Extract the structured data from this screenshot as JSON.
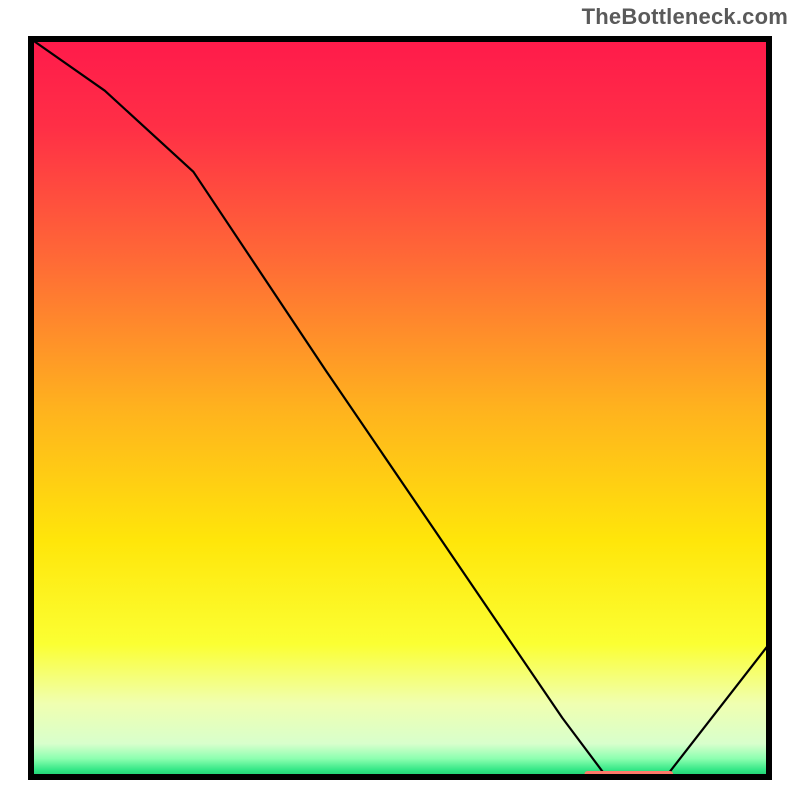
{
  "watermark": "TheBottleneck.com",
  "chart_data": {
    "type": "line",
    "title": "",
    "xlabel": "",
    "ylabel": "",
    "xlim": [
      0,
      100
    ],
    "ylim": [
      0,
      100
    ],
    "grid": false,
    "legend": false,
    "x": [
      0,
      10,
      22,
      40,
      55,
      72,
      78,
      86,
      100
    ],
    "values": [
      100,
      93,
      82,
      55,
      33,
      8,
      0,
      0,
      18
    ],
    "gradient_stops": [
      {
        "offset": 0.0,
        "color": "#ff1a4b"
      },
      {
        "offset": 0.12,
        "color": "#ff2f46"
      },
      {
        "offset": 0.3,
        "color": "#ff6a36"
      },
      {
        "offset": 0.5,
        "color": "#ffb21e"
      },
      {
        "offset": 0.68,
        "color": "#ffe60a"
      },
      {
        "offset": 0.82,
        "color": "#fbff33"
      },
      {
        "offset": 0.9,
        "color": "#f0ffb0"
      },
      {
        "offset": 0.955,
        "color": "#d8ffcc"
      },
      {
        "offset": 0.975,
        "color": "#8dffb0"
      },
      {
        "offset": 0.99,
        "color": "#35e887"
      },
      {
        "offset": 1.0,
        "color": "#18c96d"
      }
    ],
    "optimum_band": {
      "x_start": 75,
      "x_end": 87,
      "color": "#ff7a6a"
    },
    "frame_stroke": "#000000",
    "line_stroke": "#000000",
    "line_width": 2.2
  }
}
